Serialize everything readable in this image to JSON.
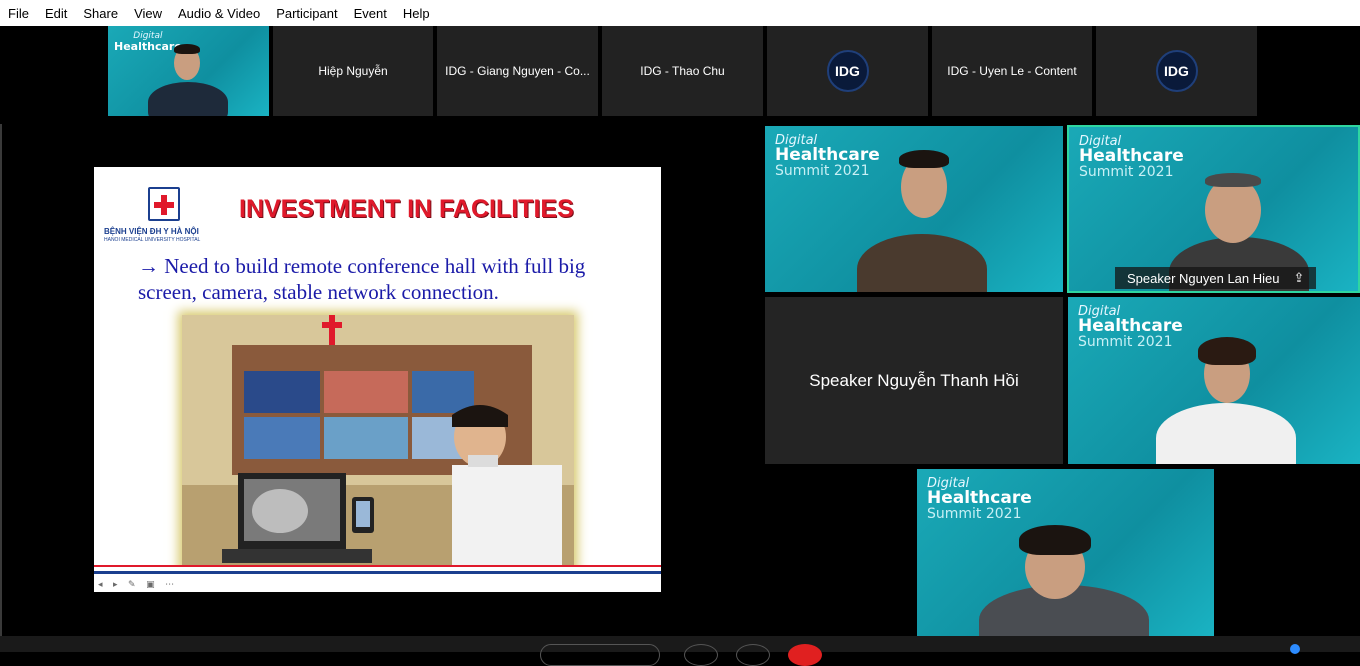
{
  "menu": {
    "items": [
      "File",
      "Edit",
      "Share",
      "View",
      "Audio & Video",
      "Participant",
      "Event",
      "Help"
    ]
  },
  "strip": {
    "tiles": [
      {
        "label": "",
        "kind": "video"
      },
      {
        "label": "Hiệp Nguyễn",
        "kind": "name"
      },
      {
        "label": "IDG - Giang Nguyen - Co...",
        "kind": "name"
      },
      {
        "label": "IDG - Thao Chu",
        "kind": "name"
      },
      {
        "label": "IDG",
        "kind": "logo"
      },
      {
        "label": "IDG - Uyen Le - Content",
        "kind": "name"
      },
      {
        "label": "IDG",
        "kind": "logo"
      }
    ]
  },
  "branding": {
    "line1": "Digital",
    "line2": "Healthcare",
    "line3": "Summit 2021",
    "idg": "IDG"
  },
  "slide": {
    "title": "INVESTMENT IN FACILITIES",
    "logo_line1": "BỆNH VIỆN ĐH Y HÀ NỘI",
    "logo_line2": "HANOI MEDICAL UNIVERSITY HOSPITAL",
    "body": "→ Need to build remote conference hall with full big screen, camera, stable network connection.",
    "controls": "◂ ▸ ✎ ▣ ⋯"
  },
  "gallery": {
    "speaker2_name": "Speaker Nguyen Lan Hieu",
    "speaker3_name": "Speaker Nguyễn Thanh Hồi"
  },
  "colors": {
    "teal": "#1aa9b7",
    "slide_title_red": "#e0192b",
    "slide_text_blue": "#1a1aa8",
    "active_speaker": "#2fd6a0"
  }
}
